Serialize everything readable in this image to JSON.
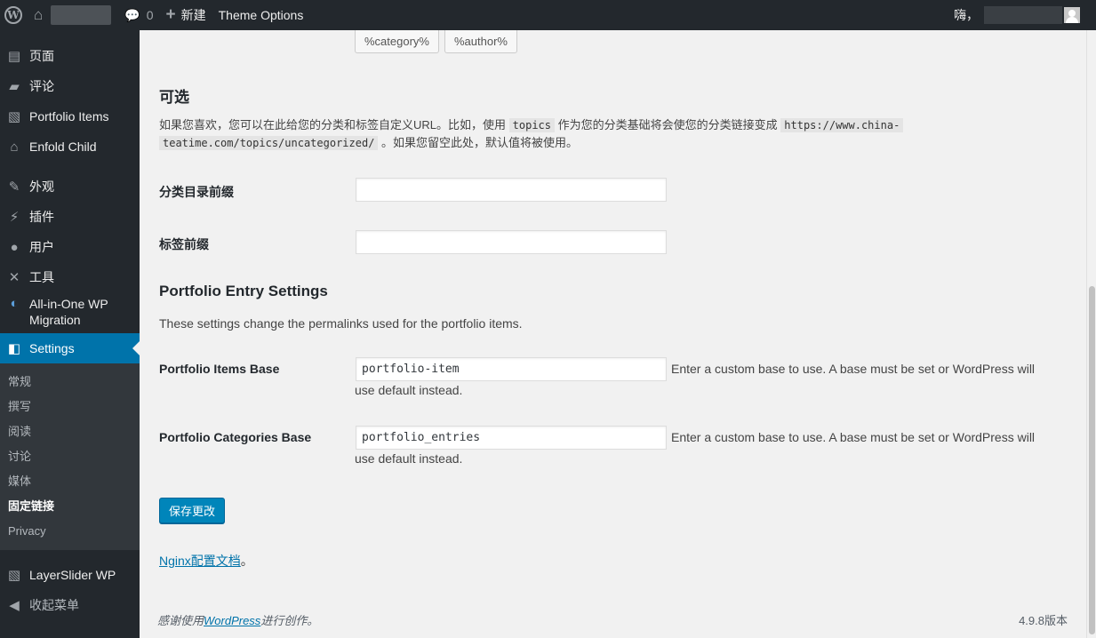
{
  "adminbar": {
    "comments_count": "0",
    "new_label": "新建",
    "theme_options": "Theme Options",
    "greeting": "嗨，"
  },
  "sidebar": {
    "partial_item": "媒体",
    "items": [
      {
        "label": "页面",
        "icon": "page-icon"
      },
      {
        "label": "评论",
        "icon": "comment-icon"
      },
      {
        "label": "Portfolio Items",
        "icon": "portfolio-icon"
      },
      {
        "label": "Enfold Child",
        "icon": "home-icon"
      },
      {
        "label": "外观",
        "icon": "brush-icon"
      },
      {
        "label": "插件",
        "icon": "plugin-icon"
      },
      {
        "label": "用户",
        "icon": "user-icon"
      },
      {
        "label": "工具",
        "icon": "wrench-icon"
      },
      {
        "label": "All-in-One WP Migration",
        "icon": "migration-icon"
      },
      {
        "label": "Settings",
        "icon": "settings-icon"
      }
    ],
    "submenu": [
      "常规",
      "撰写",
      "阅读",
      "讨论",
      "媒体",
      "固定链接",
      "Privacy"
    ],
    "layerslider": "LayerSlider WP",
    "collapse": "收起菜单"
  },
  "content": {
    "tag_buttons": [
      "%category%",
      "%author%"
    ],
    "optional_heading": "可选",
    "optional_desc_1": "如果您喜欢，您可以在此给您的分类和标签自定义URL。比如，使用",
    "optional_code_1": "topics",
    "optional_desc_2": "作为您的分类基础将会使您的分类链接变成",
    "optional_code_2a": "https://www.china-",
    "optional_code_2b": "teatime.com/topics/uncategorized/",
    "optional_desc_3": "。如果您留空此处，默认值将被使用。",
    "category_base_label": "分类目录前缀",
    "category_base_value": "",
    "tag_base_label": "标签前缀",
    "tag_base_value": "",
    "portfolio_heading": "Portfolio Entry Settings",
    "portfolio_desc": "These settings change the permalinks used for the portfolio items.",
    "items_base_label": "Portfolio Items Base",
    "items_base_value": "portfolio-item",
    "items_base_hint": "Enter a custom base to use. A base must be set or WordPress will use default instead.",
    "categories_base_label": "Portfolio Categories Base",
    "categories_base_value": "portfolio_entries",
    "categories_base_hint": "Enter a custom base to use. A base must be set or WordPress will use default instead.",
    "save_label": "保存更改",
    "nginx_link": "Nginx配置文档",
    "nginx_suffix": "。"
  },
  "footer": {
    "thanks_prefix": "感谢使用",
    "wordpress_link": "WordPress",
    "thanks_suffix": "进行创作。",
    "version": "4.9.8版本"
  }
}
